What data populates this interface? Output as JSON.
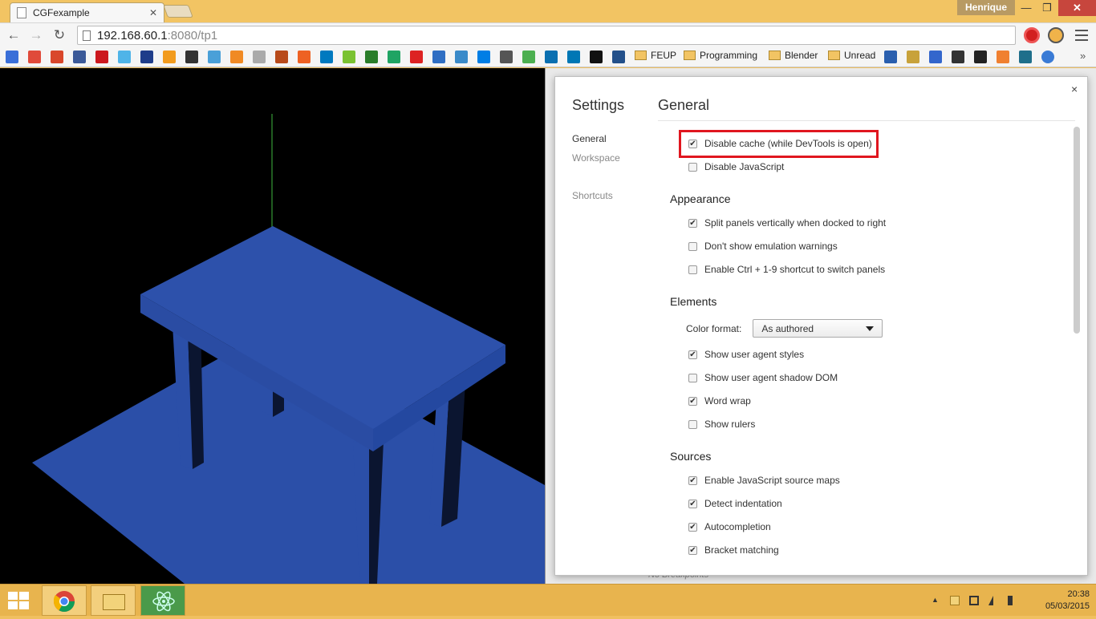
{
  "window": {
    "tab_title": "CGFexample",
    "tab_close": "✕",
    "user_name": "Henrique",
    "controls": {
      "minimize": "—",
      "maximize": "❐",
      "close": "✕"
    }
  },
  "toolbar": {
    "url_host": "192.168.60.1",
    "url_path": ":8080/tp1",
    "back": "←",
    "forward": "→",
    "reload": "↻"
  },
  "bookmarks": {
    "folders": [
      "FEUP",
      "Programming",
      "Blender",
      "Unread"
    ],
    "more": "»"
  },
  "settings": {
    "title": "Settings",
    "close": "×",
    "section": "General",
    "nav": [
      "General",
      "Workspace",
      "Shortcuts"
    ],
    "general_options": [
      {
        "label": "Disable cache (while DevTools is open)",
        "checked": true
      },
      {
        "label": "Disable JavaScript",
        "checked": false
      }
    ],
    "appearance": {
      "title": "Appearance",
      "options": [
        {
          "label": "Split panels vertically when docked to right",
          "checked": true
        },
        {
          "label": "Don't show emulation warnings",
          "checked": false
        },
        {
          "label": "Enable Ctrl + 1-9 shortcut to switch panels",
          "checked": false
        }
      ]
    },
    "elements": {
      "title": "Elements",
      "color_format_label": "Color format:",
      "color_format_value": "As authored",
      "options": [
        {
          "label": "Show user agent styles",
          "checked": true
        },
        {
          "label": "Show user agent shadow DOM",
          "checked": false
        },
        {
          "label": "Word wrap",
          "checked": true
        },
        {
          "label": "Show rulers",
          "checked": false
        }
      ]
    },
    "sources": {
      "title": "Sources",
      "options": [
        {
          "label": "Enable JavaScript source maps",
          "checked": true
        },
        {
          "label": "Detect indentation",
          "checked": true
        },
        {
          "label": "Autocompletion",
          "checked": true
        },
        {
          "label": "Bracket matching",
          "checked": true
        }
      ]
    },
    "checkmark": "✔"
  },
  "devtools_hint": "No Breakpoints",
  "taskbar": {
    "time": "20:38",
    "date": "05/03/2015"
  },
  "colors": {
    "table_blue": "#2b4fa8",
    "highlight_red": "#e0161f",
    "taskbar": "#e8b44e"
  }
}
